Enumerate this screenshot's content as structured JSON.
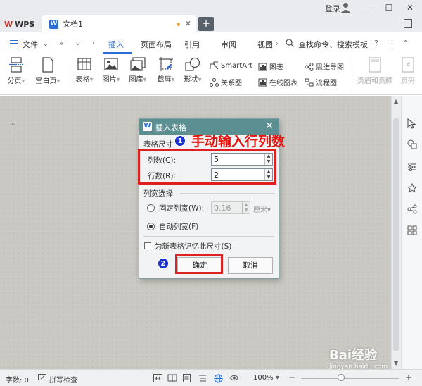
{
  "titlebar": {
    "login": "登录"
  },
  "tabs": {
    "app_name": "WPS",
    "doc_title": "文档1"
  },
  "menu": {
    "file": "文件",
    "items": [
      "插入",
      "页面布局",
      "引用",
      "审阅",
      "视图"
    ],
    "search": "查找命令、搜索模板"
  },
  "ribbon": {
    "page_break": "分页",
    "blank_page": "空白页",
    "table": "表格",
    "picture": "图片",
    "gallery": "图库",
    "screenshot": "截屏",
    "shape": "形状",
    "smartart": "SmartArt",
    "relation": "关系图",
    "chart": "图表",
    "online_chart": "在线图表",
    "mindmap": "思维导图",
    "flowchart": "流程图",
    "header_footer": "页眉和页脚",
    "page_number": "页码"
  },
  "dialog": {
    "title": "插入表格",
    "size_section": "表格尺寸",
    "columns_label": "列数(C):",
    "columns_value": "5",
    "rows_label": "行数(R):",
    "rows_value": "2",
    "width_section": "列宽选择",
    "fixed_width_label": "固定列宽(W):",
    "fixed_width_value": "0.16",
    "unit": "厘米",
    "auto_width_label": "自动列宽(F)",
    "remember_label": "为新表格记忆此尺寸(S)",
    "ok": "确定",
    "cancel": "取消"
  },
  "annotations": {
    "step1": "1",
    "step2": "2",
    "callout": "手动输入行列数"
  },
  "status": {
    "word_count": "字数: 0",
    "spellcheck": "拼写检查",
    "zoom": "100%"
  },
  "watermark": {
    "brand": "Bai经验",
    "url": "jingyan.baidu.com"
  },
  "colors": {
    "accent": "#2b6dd6",
    "dialog_title": "#5b8f92",
    "highlight_red": "#e0201e",
    "badge_blue": "#1b34d1"
  }
}
